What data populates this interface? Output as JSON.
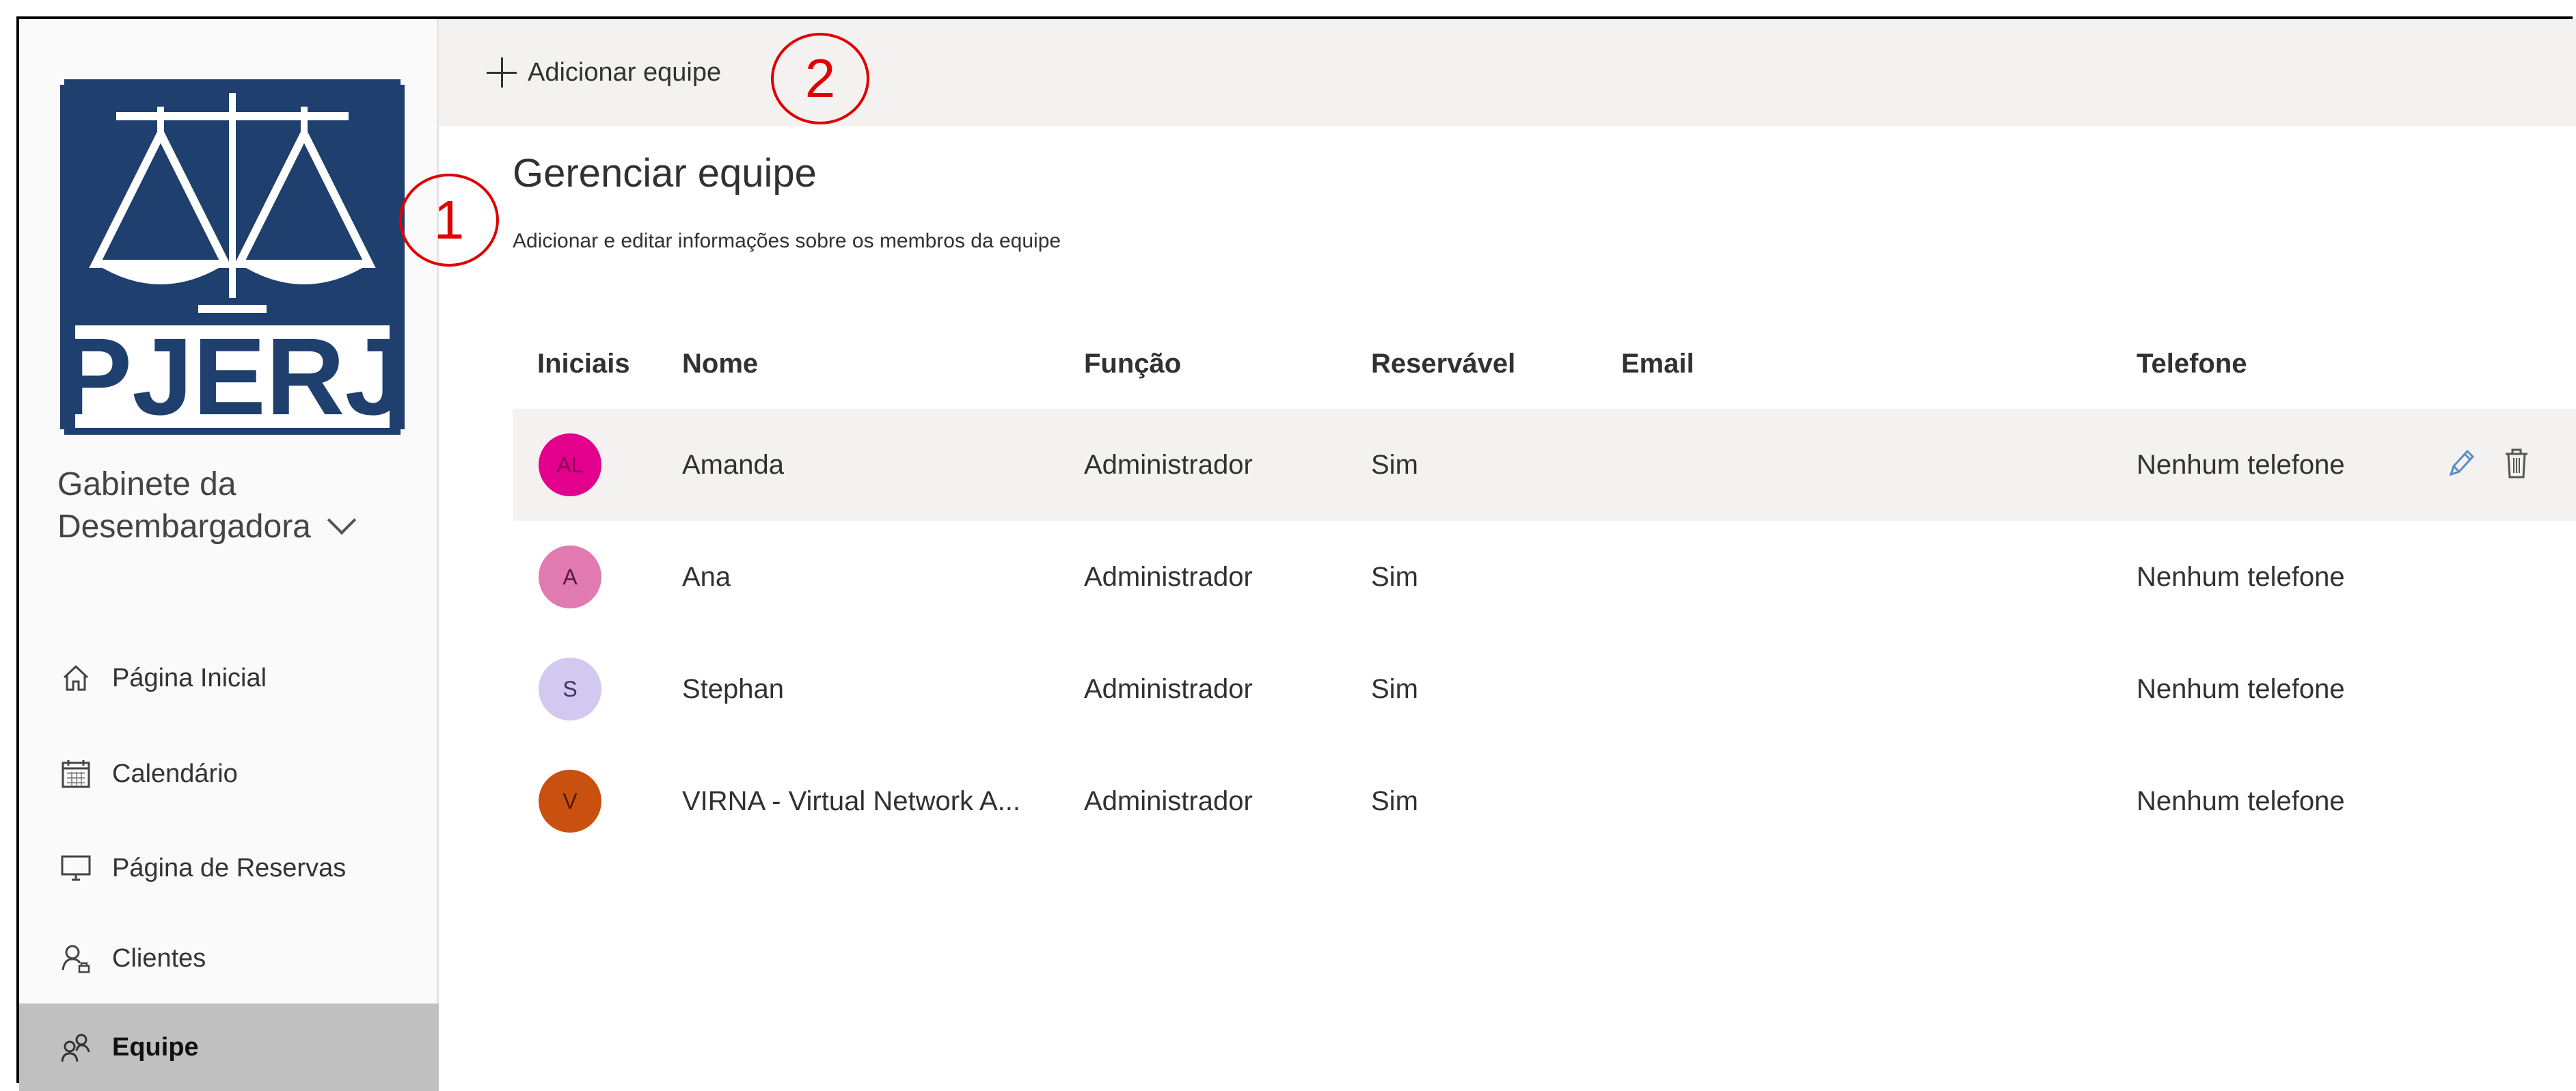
{
  "sidebar": {
    "org_line1": "Gabinete da",
    "org_line2": "Desembargadora",
    "logo_text": "PJERJ",
    "items": [
      {
        "label": "Página Inicial",
        "icon": "home-icon"
      },
      {
        "label": "Calendário",
        "icon": "calendar-icon"
      },
      {
        "label": "Página de Reservas",
        "icon": "monitor-icon"
      },
      {
        "label": "Clientes",
        "icon": "clients-icon"
      },
      {
        "label": "Equipe",
        "icon": "team-icon",
        "active": true
      }
    ]
  },
  "toolbar": {
    "add_label": "Adicionar equipe"
  },
  "callouts": [
    "1",
    "2"
  ],
  "main": {
    "title": "Gerenciar equipe",
    "subtitle": "Adicionar e editar informações sobre os membros da equipe",
    "columns": [
      "Iniciais",
      "Nome",
      "Função",
      "Reservável",
      "Email",
      "Telefone"
    ],
    "rows": [
      {
        "initials": "AL",
        "name": "Amanda",
        "role": "Administrador",
        "bookable": "Sim",
        "email": "",
        "phone": "Nenhum telefone",
        "color": "#e3008c",
        "text_color": "#8a0055"
      },
      {
        "initials": "A",
        "name": "Ana",
        "role": "Administrador",
        "bookable": "Sim",
        "email": "",
        "phone": "Nenhum telefone",
        "color": "#e07ab0",
        "text_color": "#5a1a3a"
      },
      {
        "initials": "S",
        "name": "Stephan",
        "role": "Administrador",
        "bookable": "Sim",
        "email": "",
        "phone": "Nenhum telefone",
        "color": "#d2c8f0",
        "text_color": "#3b3466"
      },
      {
        "initials": "V",
        "name": "VIRNA - Virtual Network A...",
        "role": "Administrador",
        "bookable": "Sim",
        "email": "",
        "phone": "Nenhum telefone",
        "color": "#ca5010",
        "text_color": "#4a1a00"
      }
    ]
  },
  "colors": {
    "accent_logo": "#1f3f6e",
    "callout": "#e00000",
    "active_nav": "#c0c0c0"
  }
}
